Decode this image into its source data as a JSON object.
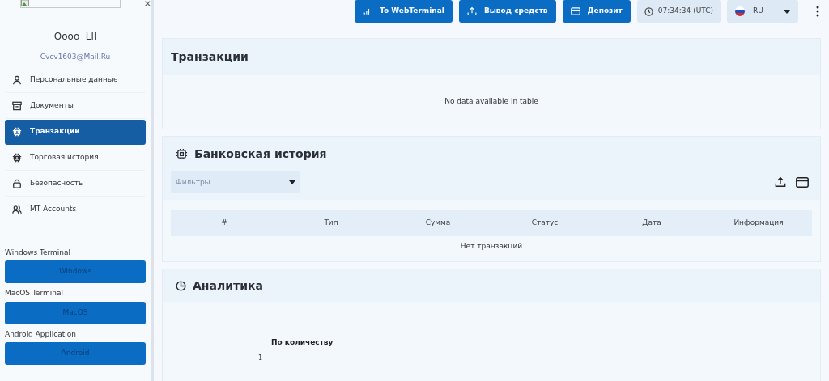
{
  "profile": {
    "name": "Oooo  Lll",
    "email": "Cvcv1603@Mail.Ru"
  },
  "nav": [
    {
      "label": "Персональные данные",
      "selected": false
    },
    {
      "label": "Документы",
      "selected": false
    },
    {
      "label": "Транзакции",
      "selected": true
    },
    {
      "label": "Торговая история",
      "selected": false
    },
    {
      "label": "Безопасность",
      "selected": false
    },
    {
      "label": "MT Accounts",
      "selected": false
    }
  ],
  "downloads": [
    {
      "caption": "Windows Terminal",
      "button": "Windows"
    },
    {
      "caption": "MacOS Terminal",
      "button": "MacOS"
    },
    {
      "caption": "Android Application",
      "button": "Android"
    }
  ],
  "topbar": {
    "buttons": [
      {
        "label": "To WebTerminal"
      },
      {
        "label": "Вывод средств"
      },
      {
        "label": "Депозит"
      }
    ],
    "clock": "07:34:34 (UTC)",
    "language": "RU"
  },
  "transactions": {
    "title": "Транзакции",
    "empty": "No data available in table"
  },
  "bank_history": {
    "title": "Банковская история",
    "filter": {
      "placeholder": "Фильтры"
    },
    "columns": [
      "#",
      "Тип",
      "Сумма",
      "Статус",
      "Дата",
      "Информация"
    ],
    "empty": "Нет транзакций"
  },
  "analytics": {
    "title": "Аналитика",
    "chart_title": "По количеству",
    "axis_label": "1"
  }
}
